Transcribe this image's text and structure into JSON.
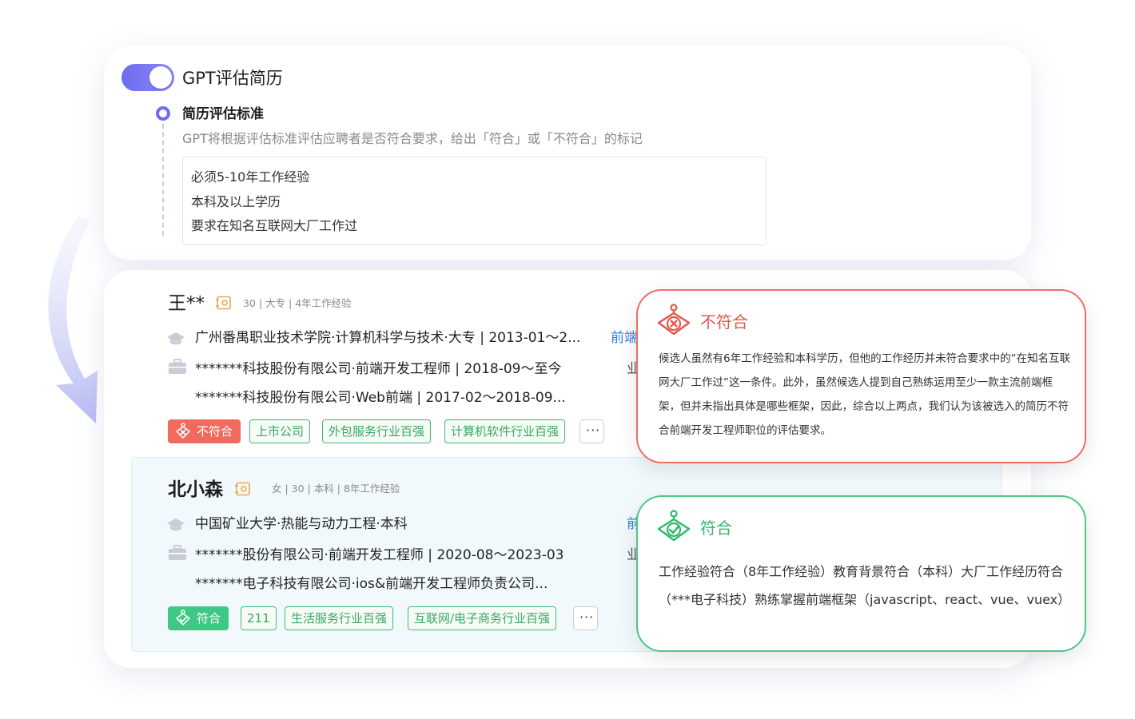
{
  "colors": {
    "accent": "#6e6cf0",
    "fail": "#ee6b5d",
    "pass": "#3ec883",
    "tag_green": "#43b977",
    "link_blue": "#2f7de1"
  },
  "evaluation": {
    "toggle_on": true,
    "title": "GPT评估简历",
    "criteria_title": "简历评估标准",
    "criteria_desc": "GPT将根据评估标准评估应聘者是否符合要求，给出「符合」或「不符合」的标记",
    "criteria_lines": [
      "必须5-10年工作经验",
      "本科及以上学历",
      "要求在知名互联网大厂工作过"
    ]
  },
  "candidates": [
    {
      "name": "王**",
      "meta": "30 | 大专 | 4年工作经验",
      "education": "广州番禺职业技术学院·计算机科学与技术·大专 | 2013-01～2...",
      "edu_side": "前端",
      "work1": "*******科技股份有限公司·前端开发工程师 | 2018-09～至今",
      "work1_side": "业",
      "work2": "*******科技股份有限公司·Web前端 | 2017-02～2018-09...",
      "badge": "不符合",
      "tags": [
        "上市公司",
        "外包服务行业百强",
        "计算机软件行业百强"
      ],
      "more": "···"
    },
    {
      "name": "北小森",
      "meta": "女 | 30 | 本科 | 8年工作经验",
      "education": "中国矿业大学·热能与动力工程·本科",
      "edu_side": "前",
      "work1": "*******股份有限公司·前端开发工程师 | 2020-08～2023-03",
      "work1_side": "业",
      "work2": "*******电子科技有限公司·ios&前端开发工程师负责公司...",
      "badge": "符合",
      "tags": [
        "211",
        "生活服务行业百强",
        "互联网/电子商务行业百强"
      ],
      "more": "···"
    }
  ],
  "results": {
    "fail": {
      "title": "不符合",
      "body": "候选人虽然有6年工作经验和本科学历，但他的工作经历并未符合要求中的“在知名互联网大厂工作过”这一条件。此外，虽然候选人提到自己熟练运用至少一款主流前端框架，但并未指出具体是哪些框架，因此，综合以上两点，我们认为该被选入的简历不符合前端开发工程师职位的评估要求。"
    },
    "pass": {
      "title": "符合",
      "body": "工作经验符合（8年工作经验）教育背景符合（本科）大厂工作经历符合（***电子科技）熟练掌握前端框架（javascript、react、vue、vuex）"
    }
  },
  "icons": {
    "toggle": "toggle-switch",
    "step": "timeline-dot-icon",
    "resume": "resume-icon",
    "education": "graduation-cap-icon",
    "work": "briefcase-icon",
    "fail": "robot-x-icon",
    "pass": "robot-check-icon",
    "decor": "curved-arrow-icon"
  }
}
